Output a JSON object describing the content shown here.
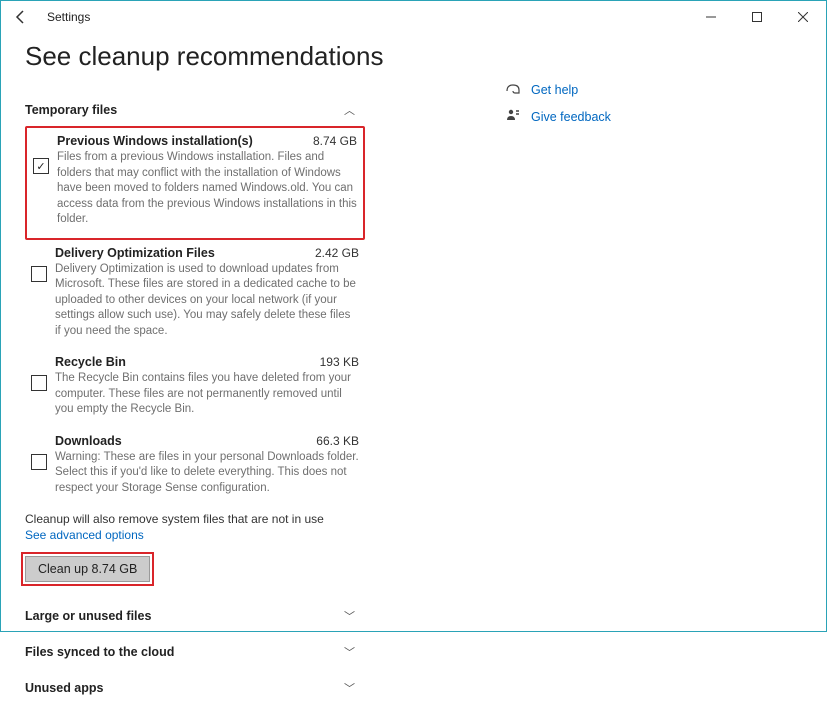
{
  "window": {
    "title": "Settings"
  },
  "page": {
    "heading": "See cleanup recommendations"
  },
  "sections": {
    "temp": {
      "label": "Temporary files",
      "expanded": true,
      "items": [
        {
          "title": "Previous Windows installation(s)",
          "size": "8.74 GB",
          "desc": "Files from a previous Windows installation.  Files and folders that may conflict with the installation of Windows have been moved to folders named Windows.old.  You can access data from the previous Windows installations in this folder.",
          "checked": true
        },
        {
          "title": "Delivery Optimization Files",
          "size": "2.42 GB",
          "desc": "Delivery Optimization is used to download updates from Microsoft. These files are stored in a dedicated cache to be uploaded to other devices on your local network (if your settings allow such use). You may safely delete these files if you need the space.",
          "checked": false
        },
        {
          "title": "Recycle Bin",
          "size": "193 KB",
          "desc": "The Recycle Bin contains files you have deleted from your computer. These files are not permanently removed until you empty the Recycle Bin.",
          "checked": false
        },
        {
          "title": "Downloads",
          "size": "66.3 KB",
          "desc": "Warning: These are files in your personal Downloads folder. Select this if you'd like to delete everything. This does not respect your Storage Sense configuration.",
          "checked": false
        }
      ],
      "note": "Cleanup will also remove system files that are not in use",
      "advanced_link": "See advanced options",
      "button": "Clean up 8.74 GB"
    },
    "large": {
      "label": "Large or unused files"
    },
    "cloud": {
      "label": "Files synced to the cloud"
    },
    "apps": {
      "label": "Unused apps"
    }
  },
  "side": {
    "help": "Get help",
    "feedback": "Give feedback"
  }
}
